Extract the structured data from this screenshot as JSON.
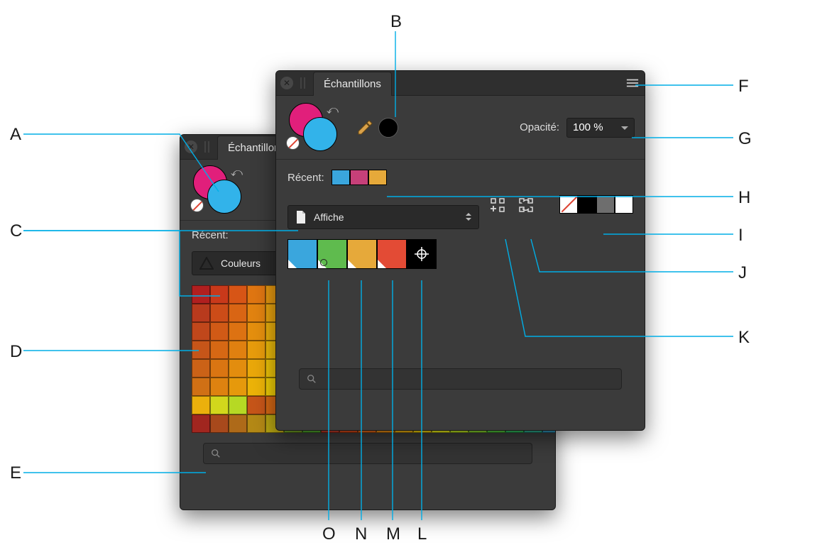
{
  "callouts": {
    "A": "A",
    "B": "B",
    "C": "C",
    "D": "D",
    "E": "E",
    "F": "F",
    "G": "G",
    "H": "H",
    "I": "I",
    "J": "J",
    "K": "K",
    "L": "L",
    "M": "M",
    "N": "N",
    "O": "O"
  },
  "panel_front": {
    "tab_title": "Échantillons",
    "opacity_label": "Opacité:",
    "opacity_value": "100 %",
    "recent_label": "Récent:",
    "recent_colors": [
      "#3aa6dd",
      "#c74079",
      "#e6a93a"
    ],
    "palette_name": "Affiche",
    "palette_swatches": [
      {
        "color": "#3aa6dd",
        "global": true,
        "spot": false
      },
      {
        "color": "#5fbb4e",
        "global": true,
        "spot": true
      },
      {
        "color": "#e6a93a",
        "global": true,
        "spot": false
      },
      {
        "color": "#e34b35",
        "global": true,
        "spot": false
      }
    ],
    "utility_swatches": [
      {
        "kind": "none",
        "color": "#ffffff"
      },
      {
        "kind": "solid",
        "color": "#000000"
      },
      {
        "kind": "solid",
        "color": "#6e6e6e"
      },
      {
        "kind": "solid",
        "color": "#ffffff"
      }
    ],
    "fill_color": "#e11f7b",
    "stroke_color": "#32b3ea"
  },
  "panel_rear": {
    "tab_title": "Échantillons",
    "recent_label": "Récent:",
    "palette_name": "Couleurs",
    "fill_color": "#e11f7b",
    "stroke_color": "#32b3ea",
    "grid_colors": [
      "#b11f1f",
      "#c9391a",
      "#d75516",
      "#e07612",
      "#e89910",
      "#b8c020",
      "#9ac828",
      "#b83a1d",
      "#cc4c18",
      "#d96514",
      "#e28310",
      "#e9a40e",
      "#c7cc1e",
      "#a9d126",
      "#c0471b",
      "#d15a16",
      "#dd7212",
      "#e58f0e",
      "#ebb00c",
      "#d2d71c",
      "#b6d924",
      "#c65519",
      "#d66814",
      "#e08010",
      "#e79c0c",
      "#edbb0a",
      "#dbe01a",
      "#c1e022",
      "#cb6217",
      "#da7512",
      "#e38d0e",
      "#eaa80a",
      "#efc508",
      "#e2e818",
      "#cbe720",
      "#d07015",
      "#de8210",
      "#e6990c",
      "#ecb308",
      "#f0ce06",
      "#e9ef16",
      "#d4ed1e",
      "#a1261f",
      "#a8491c",
      "#ae6a19",
      "#b48916",
      "#b9a613",
      "#6f9d23",
      "#4ea42a",
      "#bf3826",
      "#d44716",
      "#e06514",
      "#e88b10",
      "#ecae0d",
      "#f0ce0a",
      "#e9ec15",
      "#bde31e",
      "#86d22a",
      "#4fc238",
      "#2fb55a",
      "#2aa58a",
      "#2f8fb5",
      "#3b74cf",
      "#5a56d6",
      "#7e42cd",
      "#9e35c0",
      "#b72faf",
      "#c92e96",
      "#d23378"
    ]
  }
}
